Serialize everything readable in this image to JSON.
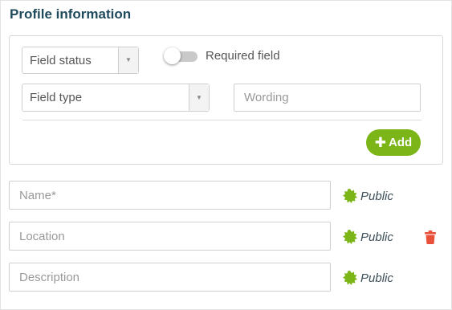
{
  "page": {
    "title": "Profile information"
  },
  "form": {
    "field_status": {
      "value": "Field status",
      "arrow": "▼"
    },
    "required_toggle": {
      "label": "Required field",
      "on": false
    },
    "field_type": {
      "value": "Field type",
      "arrow": "▼"
    },
    "wording": {
      "placeholder": "Wording"
    },
    "add_button": {
      "icon": "plus-icon",
      "label": "Add"
    }
  },
  "fields": [
    {
      "placeholder": "Name*",
      "visibility": "Public",
      "deletable": false
    },
    {
      "placeholder": "Location",
      "visibility": "Public",
      "deletable": true
    },
    {
      "placeholder": "Description",
      "visibility": "Public",
      "deletable": false
    }
  ],
  "colors": {
    "title": "#1f4a5c",
    "accent_green": "#7cb518",
    "public_badge": "#7cb518",
    "delete_red": "#e8503a"
  },
  "icons": {
    "visibility_badge": "public-badge-icon",
    "delete": "trash-icon"
  }
}
